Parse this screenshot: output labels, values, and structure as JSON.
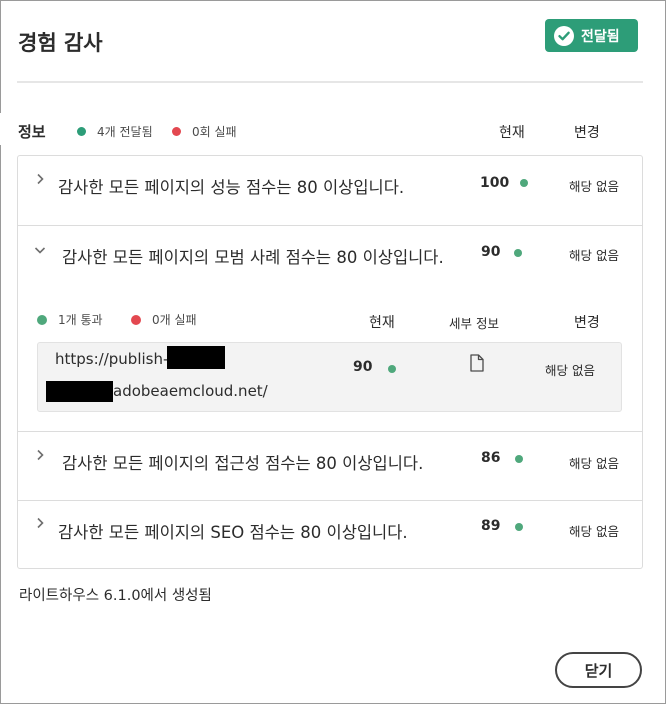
{
  "dialog": {
    "title": "경험 감사"
  },
  "status": {
    "label": "전달됨",
    "icon": "check-circle-icon",
    "color": "#2d9d78"
  },
  "summary": {
    "title": "정보",
    "delivered_label": "4개 전달됨",
    "failed_label": "0회 실패",
    "col_current": "현재",
    "col_change": "변경"
  },
  "audits": [
    {
      "label": "감사한 모든 페이지의 성능 점수는 80 이상입니다.",
      "score": "100",
      "change": "해당 없음",
      "expanded": false
    },
    {
      "label": "감사한 모든 페이지의 모범 사례 점수는 80 이상입니다.",
      "score": "90",
      "change": "해당 없음",
      "expanded": true,
      "detail": {
        "passed_label": "1개 통과",
        "failed_label": "0개 실패",
        "col_current": "현재",
        "col_details": "세부 정보",
        "col_change": "변경",
        "page": {
          "url_part1": "https://publish-",
          "url_part2": "adobeaemcloud.net/",
          "score": "90",
          "details_icon": "document-icon",
          "change": "해당 없음"
        }
      }
    },
    {
      "label": "감사한 모든 페이지의 접근성 점수는 80 이상입니다.",
      "score": "86",
      "change": "해당 없음",
      "expanded": false
    },
    {
      "label": "감사한 모든 페이지의 SEO 점수는 80 이상입니다.",
      "score": "89",
      "change": "해당 없음",
      "expanded": false
    }
  ],
  "footer": {
    "note": "라이트하우스 6.1.0에서 생성됨"
  },
  "actions": {
    "close_label": "닫기"
  },
  "colors": {
    "pass": "#2d9d78",
    "fail": "#e34850",
    "score_dot": "#4fa87c"
  }
}
